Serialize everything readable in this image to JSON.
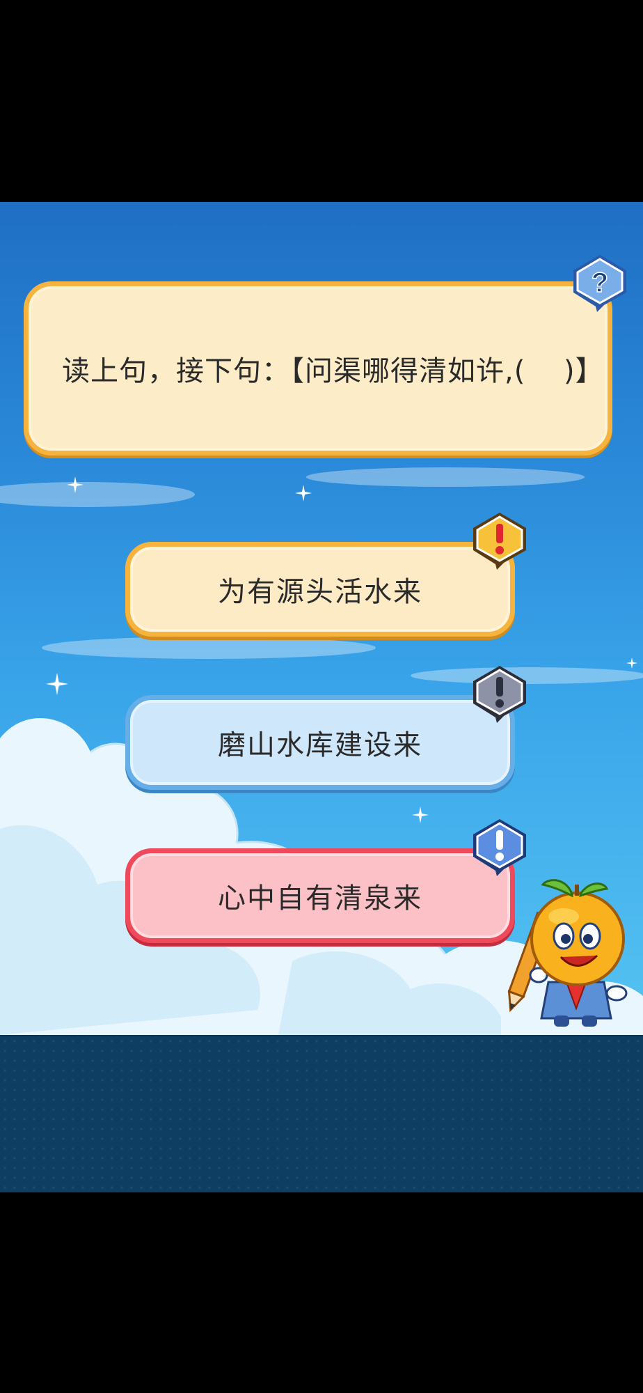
{
  "question": {
    "text": "读上句，接下句：【问渠哪得清如许,(　 )】",
    "badge_icon": "question-mark-icon"
  },
  "options": [
    {
      "label": "为有源头活水来",
      "state": "normal",
      "color": "#fdebc6",
      "badge_icon": "exclamation-red-icon"
    },
    {
      "label": "磨山水库建设来",
      "state": "disabled",
      "color": "#cfe7fb",
      "badge_icon": "exclamation-gray-icon"
    },
    {
      "label": "心中自有清泉来",
      "state": "wrong",
      "color": "#fcc1c6",
      "badge_icon": "exclamation-blue-icon"
    }
  ],
  "mascot": {
    "icon": "orange-mascot-icon"
  },
  "colors": {
    "sky_top": "#1f6fc4",
    "sky_bottom": "#56c3f2",
    "panel": "#0e3f63",
    "gold_border": "#f6b43f",
    "blue_border": "#66aee8",
    "red_border": "#ef4a5c"
  }
}
